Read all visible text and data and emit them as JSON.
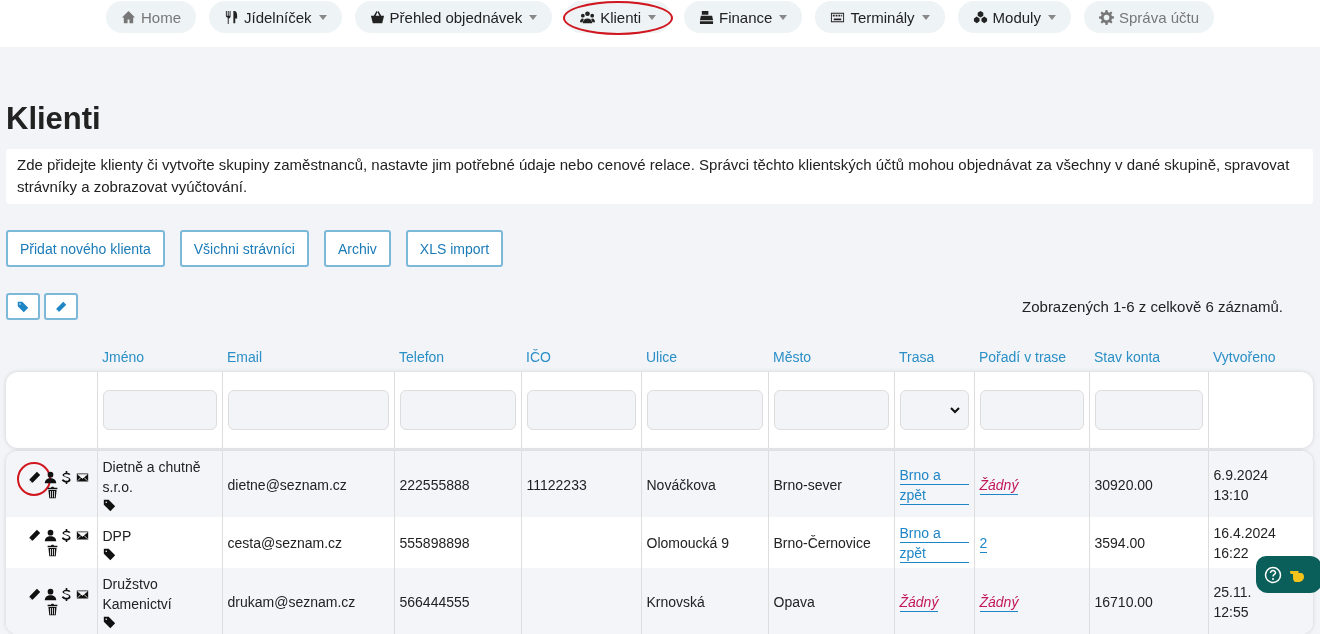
{
  "nav": [
    {
      "label": "Home",
      "dropdown": false,
      "disabled": true,
      "highlighted": false
    },
    {
      "label": "Jídelníček",
      "dropdown": true,
      "disabled": false,
      "highlighted": false
    },
    {
      "label": "Přehled objednávek",
      "dropdown": true,
      "disabled": false,
      "highlighted": false
    },
    {
      "label": "Klienti",
      "dropdown": true,
      "disabled": false,
      "highlighted": true
    },
    {
      "label": "Finance",
      "dropdown": true,
      "disabled": false,
      "highlighted": false
    },
    {
      "label": "Terminály",
      "dropdown": true,
      "disabled": false,
      "highlighted": false
    },
    {
      "label": "Moduly",
      "dropdown": true,
      "disabled": false,
      "highlighted": false
    },
    {
      "label": "Správa účtu",
      "dropdown": false,
      "disabled": true,
      "highlighted": false
    }
  ],
  "title": "Klienti",
  "description": "Zde přidejte klienty či vytvořte skupiny zaměstnanců, nastavte jim potřebné údaje nebo cenové relace. Správci těchto klientských účtů mohou objednávat za všechny v dané skupině, spravovat strávníky a zobrazovat vyúčtování.",
  "buttons": [
    "Přidat nového klienta",
    "Všichni strávníci",
    "Archiv",
    "XLS import"
  ],
  "summary": "Zobrazených 1-6 z celkově 6 záznamů.",
  "table": {
    "columns": [
      {
        "label": "Jméno",
        "kind": "text"
      },
      {
        "label": "Email",
        "kind": "text"
      },
      {
        "label": "Telefon",
        "kind": "text"
      },
      {
        "label": "IČO",
        "kind": "text"
      },
      {
        "label": "Ulice",
        "kind": "text"
      },
      {
        "label": "Město",
        "kind": "text"
      },
      {
        "label": "Trasa",
        "kind": "select"
      },
      {
        "label": "Pořadí v trase",
        "kind": "text"
      },
      {
        "label": "Stav konta",
        "kind": "text"
      },
      {
        "label": "Vytvořeno",
        "kind": "none"
      }
    ],
    "rows": [
      {
        "edit_highlighted": true,
        "name": "Dietně a chutně s.r.o.",
        "email": "dietne@seznam.cz",
        "phone": "222555888",
        "ico": "11122233",
        "street": "Nováčkova",
        "city": "Brno-sever",
        "route": {
          "text": "Brno a zpět",
          "kind": "link"
        },
        "order": {
          "text": "Žádný",
          "kind": "none"
        },
        "balance": "30920.00",
        "created": [
          "6.9.2024",
          "13:10"
        ]
      },
      {
        "edit_highlighted": false,
        "name": "DPP",
        "email": "cesta@seznam.cz",
        "phone": "555898898",
        "street": "Olomoucká 9",
        "city": "Brno-Černovice",
        "route": {
          "text": "Brno a zpět",
          "kind": "link"
        },
        "order": {
          "text": "2",
          "kind": "link"
        },
        "balance": "3594.00",
        "created": [
          "16.4.2024",
          "16:22"
        ]
      },
      {
        "edit_highlighted": false,
        "name": "Družstvo Kamenictví",
        "email": "drukam@seznam.cz",
        "phone": "566444555",
        "street": "Krnovská",
        "city": "Opava",
        "route": {
          "text": "Žádný",
          "kind": "none"
        },
        "order": {
          "text": "Žádný",
          "kind": "none"
        },
        "balance": "16710.00",
        "created": [
          "25.11.",
          "12:55"
        ]
      }
    ]
  }
}
